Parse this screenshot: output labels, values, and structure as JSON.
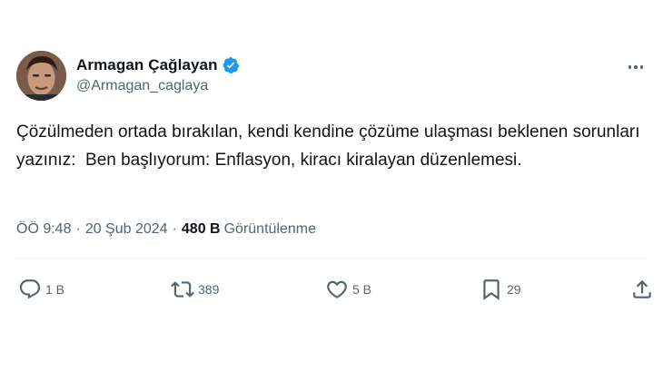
{
  "author": {
    "display_name": "Armagan Çağlayan",
    "handle": "@Armagan_caglaya",
    "verified": true,
    "avatar_icon": "profile-photo"
  },
  "tweet": {
    "text": "Çözülmeden ortada bırakılan, kendi kendine çözüme ulaşması beklenen sorunları yazınız:  Ben başlıyorum: Enflasyon, kiracı kiralayan düzenlemesi.",
    "time": "ÖÖ 9:48",
    "separator": "·",
    "date": "20 Şub 2024",
    "views_count": "480 B",
    "views_label": "Görüntülenme"
  },
  "actions": {
    "replies": "1 B",
    "retweets": "389",
    "likes": "5 B",
    "bookmarks": "29"
  },
  "colors": {
    "text": "#0f1419",
    "secondary": "#536471",
    "verified": "#1d9bf0",
    "divider": "#eff3f4"
  }
}
